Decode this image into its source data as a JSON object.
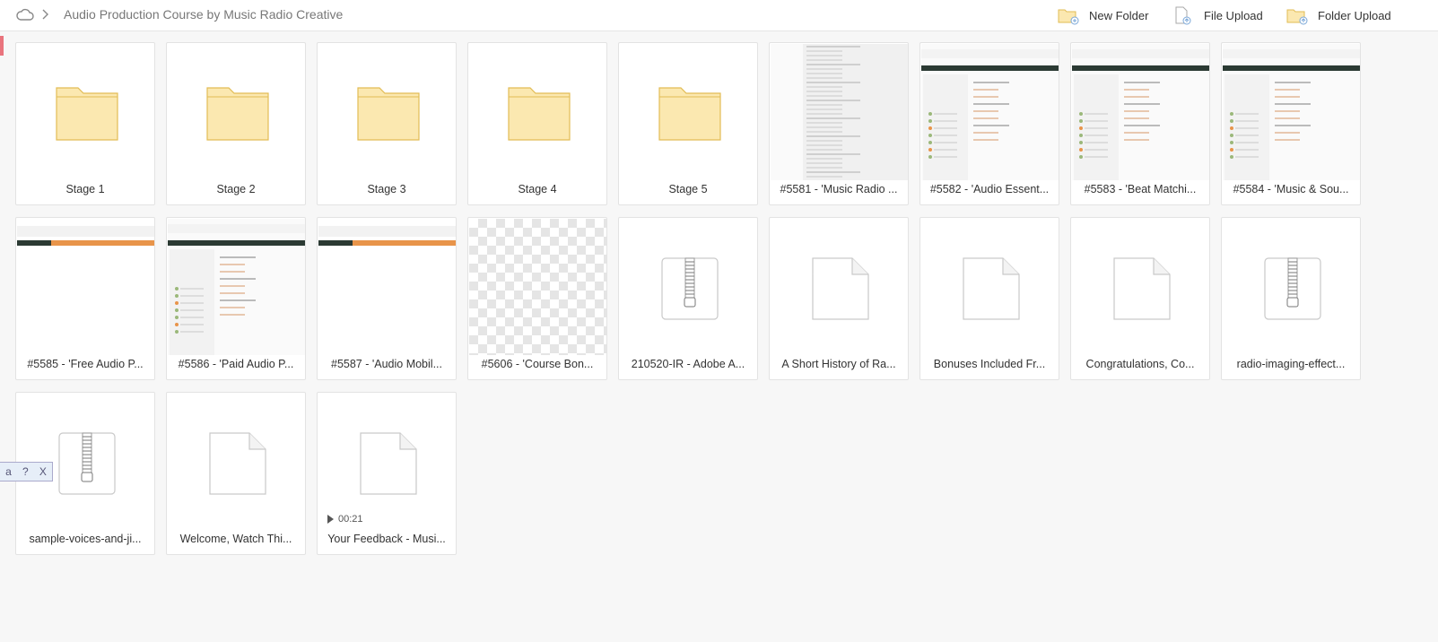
{
  "breadcrumb": {
    "path": "Audio Production Course by Music Radio Creative"
  },
  "toolbar": {
    "new_folder": "New Folder",
    "file_upload": "File Upload",
    "folder_upload": "Folder Upload"
  },
  "items": [
    {
      "label": "Stage 1",
      "kind": "folder"
    },
    {
      "label": "Stage 2",
      "kind": "folder"
    },
    {
      "label": "Stage 3",
      "kind": "folder"
    },
    {
      "label": "Stage 4",
      "kind": "folder"
    },
    {
      "label": "Stage 5",
      "kind": "folder"
    },
    {
      "label": "#5581 - 'Music Radio ...",
      "kind": "screenshot-list"
    },
    {
      "label": "#5582 - 'Audio Essent...",
      "kind": "screenshot-page"
    },
    {
      "label": "#5583 - 'Beat Matchi...",
      "kind": "screenshot-page"
    },
    {
      "label": "#5584 - 'Music & Sou...",
      "kind": "screenshot-page"
    },
    {
      "label": "#5585 - 'Free Audio P...",
      "kind": "screenshot-banner"
    },
    {
      "label": "#5586 - 'Paid Audio P...",
      "kind": "screenshot-page"
    },
    {
      "label": "#5587 - 'Audio Mobil...",
      "kind": "screenshot-banner"
    },
    {
      "label": "#5606 - 'Course Bon...",
      "kind": "transparent"
    },
    {
      "label": "210520-IR - Adobe A...",
      "kind": "zip"
    },
    {
      "label": "A Short History of Ra...",
      "kind": "document"
    },
    {
      "label": "Bonuses Included Fr...",
      "kind": "document"
    },
    {
      "label": "Congratulations, Co...",
      "kind": "document"
    },
    {
      "label": "radio-imaging-effect...",
      "kind": "zip"
    },
    {
      "label": "sample-voices-and-ji...",
      "kind": "zip"
    },
    {
      "label": "Welcome, Watch Thi...",
      "kind": "document"
    },
    {
      "label": "Your Feedback - Musi...",
      "kind": "video",
      "duration": "00:21"
    }
  ],
  "help_widget": {
    "left": "a",
    "help": "?",
    "close": "X"
  },
  "colors": {
    "folder_fill": "#fbe8b0",
    "folder_stroke": "#e2bc55",
    "accent_orange": "#e8944a",
    "dark_green": "#2b3a33"
  }
}
